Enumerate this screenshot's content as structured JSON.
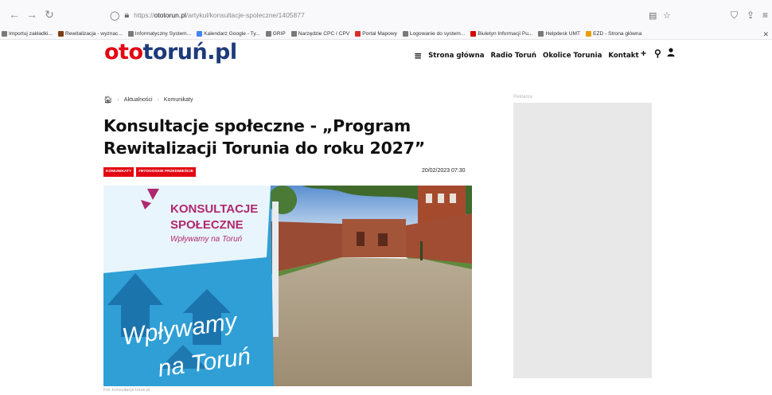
{
  "browser": {
    "url_prefix": "https://",
    "url_host": "ototorun.pl",
    "url_path": "/artykul/konsultacje-spoleczne/1405877"
  },
  "bookmarks": [
    {
      "label": "Importuj zakładki...",
      "color": "#7a7a7a"
    },
    {
      "label": "Rewitalizacja - wyznac...",
      "color": "#7b3f12"
    },
    {
      "label": "Informatyczny System...",
      "color": "#7a7a7a"
    },
    {
      "label": "Kalendarz Google - Ty...",
      "color": "#4285f4"
    },
    {
      "label": "GRIP",
      "color": "#7a7a7a"
    },
    {
      "label": "Narzędzie CPC / CPV",
      "color": "#7a7a7a"
    },
    {
      "label": "Portal Mapowy",
      "color": "#d93025"
    },
    {
      "label": "Logowanie do system...",
      "color": "#7a7a7a"
    },
    {
      "label": "Biuletyn Informacji Pu...",
      "color": "#d40000"
    },
    {
      "label": "Helpdesk UMT",
      "color": "#7a7a7a"
    },
    {
      "label": "EZD - Strona główna",
      "color": "#e6a000"
    }
  ],
  "site": {
    "logo_part1": "oto",
    "logo_part2": "toruń.pl",
    "nav": [
      "Strona główna",
      "Radio Toruń",
      "Okolice Torunia",
      "Kontakt"
    ]
  },
  "article": {
    "breadcrumbs": [
      "Aktualności",
      "Komunikaty"
    ],
    "title": "Konsultacje społeczne - „Program Rewitalizacji Torunia do roku 2027”",
    "tags": [
      "KOMUNIKATY",
      "#BYDGOSKIE PRZEDMIEŚCIE"
    ],
    "date": "20/02/2023 07:30",
    "photo_banner_line1": "KONSULTACJE",
    "photo_banner_line2": "SPOŁECZNE",
    "photo_banner_line3": "Wpływamy na Toruń",
    "photo_big_line1": "Wpływamy",
    "photo_big_line2": "na Toruń",
    "caption": "Fot. konsultacje.torun.pl"
  },
  "sidebar": {
    "ad_label": "Reklama"
  },
  "colors": {
    "brand_red": "#e30613",
    "brand_blue": "#1d3a7a",
    "banner_blue": "#2f9fd6"
  }
}
